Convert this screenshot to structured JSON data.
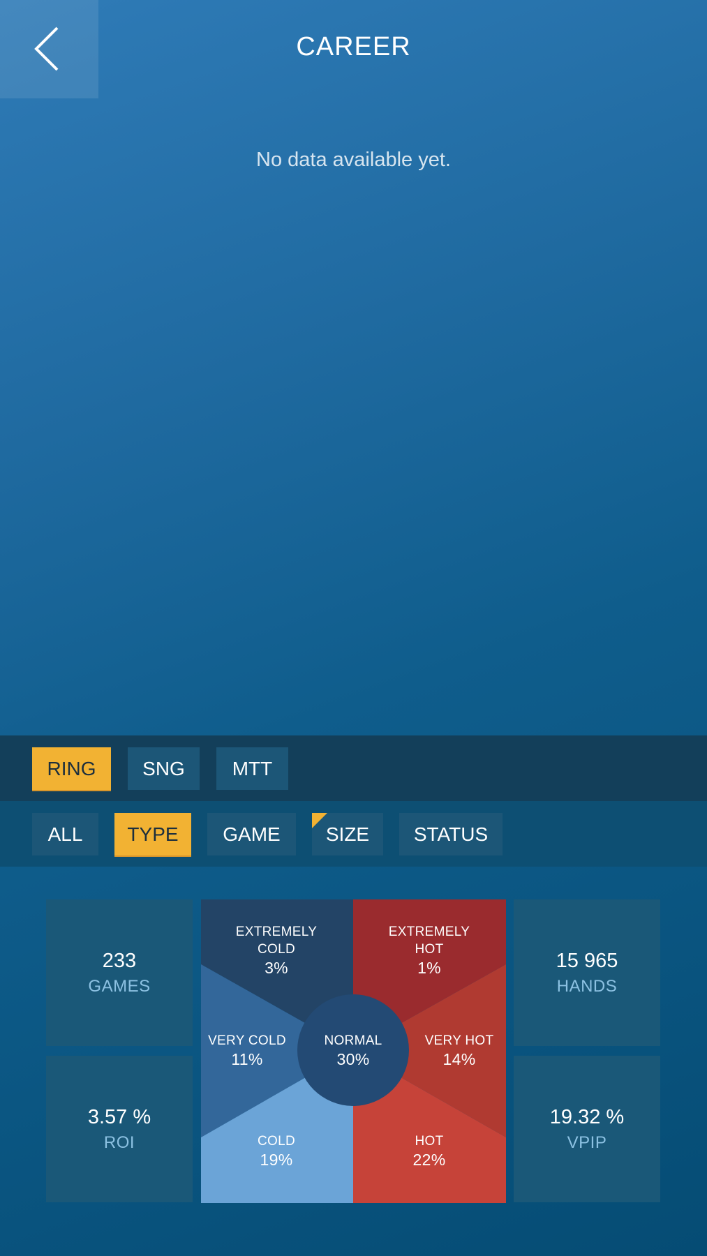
{
  "header": {
    "title": "CAREER",
    "back_icon": "chevron-left-icon"
  },
  "empty_message": "No data available yet.",
  "game_type_tabs": [
    {
      "label": "RING",
      "active": true
    },
    {
      "label": "SNG",
      "active": false
    },
    {
      "label": "MTT",
      "active": false
    }
  ],
  "filter_tabs": [
    {
      "label": "ALL",
      "active": false
    },
    {
      "label": "TYPE",
      "active": true
    },
    {
      "label": "GAME",
      "active": false
    },
    {
      "label": "SIZE",
      "active": false,
      "marker": true
    },
    {
      "label": "STATUS",
      "active": false
    }
  ],
  "stats": {
    "games": {
      "value": "233",
      "label": "GAMES"
    },
    "hands": {
      "value": "15 965",
      "label": "HANDS"
    },
    "roi": {
      "value": "3.57 %",
      "label": "ROI"
    },
    "vpip": {
      "value": "19.32 %",
      "label": "VPIP"
    }
  },
  "heat": {
    "extremely_cold": {
      "label_line1": "EXTREMELY",
      "label_line2": "COLD",
      "pct": "3%"
    },
    "extremely_hot": {
      "label_line1": "EXTREMELY",
      "label_line2": "HOT",
      "pct": "1%"
    },
    "very_cold": {
      "label": "VERY COLD",
      "pct": "11%"
    },
    "normal": {
      "label": "NORMAL",
      "pct": "30%"
    },
    "very_hot": {
      "label": "VERY HOT",
      "pct": "14%"
    },
    "cold": {
      "label": "COLD",
      "pct": "19%"
    },
    "hot": {
      "label": "HOT",
      "pct": "22%"
    }
  },
  "colors": {
    "accent": "#f2b233",
    "extremely_cold": "#234466",
    "very_cold": "#33679a",
    "cold": "#6ba4d7",
    "normal": "#234a74",
    "extremely_hot": "#9a2b2e",
    "very_hot": "#b03a31",
    "hot": "#c64339"
  }
}
